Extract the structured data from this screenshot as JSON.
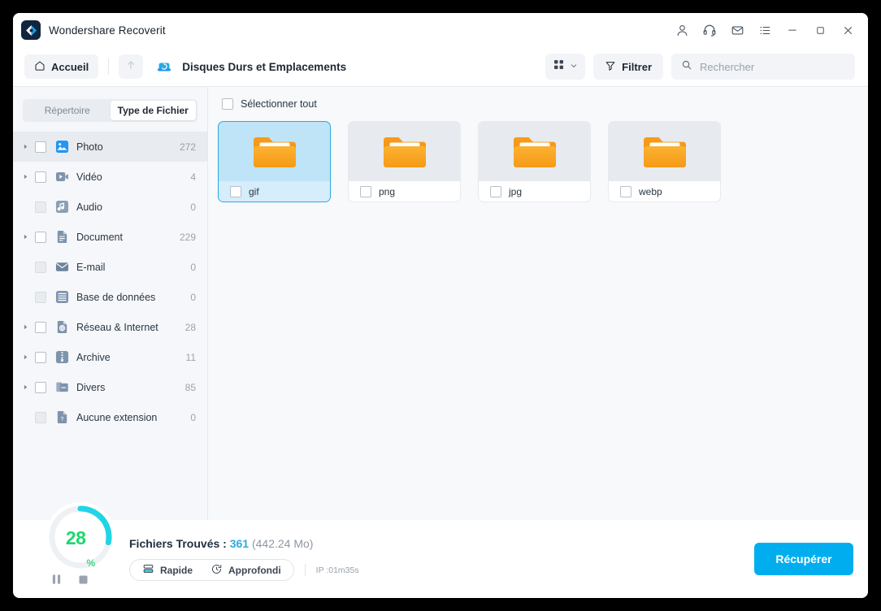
{
  "titlebar": {
    "app_title": "Wondershare Recoverit",
    "logo_name": "wondershare-logo",
    "icons": [
      {
        "name": "account-icon",
        "glyph": "user"
      },
      {
        "name": "support-headset-icon",
        "glyph": "headset"
      },
      {
        "name": "mail-icon",
        "glyph": "mail"
      },
      {
        "name": "menu-list-icon",
        "glyph": "list"
      }
    ],
    "minimize": "minimize-button",
    "maximize": "maximize-button",
    "close": "close-button"
  },
  "toolbar": {
    "home_label": "Accueil",
    "up_label": "up-level-button",
    "location_title": "Disques Durs et Emplacements",
    "filter_label": "Filtrer",
    "view_label": "view-mode-button",
    "search_placeholder": "Rechercher",
    "search_value": ""
  },
  "sidebar": {
    "tabs": [
      {
        "label": "Répertoire",
        "active": false
      },
      {
        "label": "Type de Fichier",
        "active": true
      }
    ],
    "categories": [
      {
        "label": "Photo",
        "count": "272",
        "icon": "photo-icon",
        "color": "#2196f3",
        "expandable": true,
        "enabled": true,
        "selected": true
      },
      {
        "label": "Vidéo",
        "count": "4",
        "icon": "video-icon",
        "color": "#7e93ac",
        "expandable": true,
        "enabled": true,
        "selected": false
      },
      {
        "label": "Audio",
        "count": "0",
        "icon": "audio-icon",
        "color": "#8ba0b6",
        "expandable": false,
        "enabled": false,
        "selected": false
      },
      {
        "label": "Document",
        "count": "229",
        "icon": "document-icon",
        "color": "#7e93ac",
        "expandable": true,
        "enabled": true,
        "selected": false
      },
      {
        "label": "E-mail",
        "count": "0",
        "icon": "email-icon",
        "color": "#6d839c",
        "expandable": false,
        "enabled": false,
        "selected": false
      },
      {
        "label": "Base de données",
        "count": "0",
        "icon": "database-icon",
        "color": "#7e93ac",
        "expandable": false,
        "enabled": false,
        "selected": false
      },
      {
        "label": "Réseau & Internet",
        "count": "28",
        "icon": "network-icon",
        "color": "#7e93ac",
        "expandable": true,
        "enabled": true,
        "selected": false
      },
      {
        "label": "Archive",
        "count": "11",
        "icon": "archive-icon",
        "color": "#7e93ac",
        "expandable": true,
        "enabled": true,
        "selected": false
      },
      {
        "label": "Divers",
        "count": "85",
        "icon": "misc-icon",
        "color": "#7e93ac",
        "expandable": true,
        "enabled": true,
        "selected": false
      },
      {
        "label": "Aucune extension",
        "count": "0",
        "icon": "unknown-file-icon",
        "color": "#7e93ac",
        "expandable": false,
        "enabled": false,
        "selected": false
      }
    ]
  },
  "content": {
    "select_all_label": "Sélectionner tout",
    "select_all_checked": false,
    "cards": [
      {
        "name": "gif",
        "selected": true,
        "checked": false
      },
      {
        "name": "png",
        "selected": false,
        "checked": false
      },
      {
        "name": "jpg",
        "selected": false,
        "checked": false
      },
      {
        "name": "webp",
        "selected": false,
        "checked": false
      }
    ]
  },
  "bottombar": {
    "progress_value": "28",
    "progress_sign": "%",
    "progress_ratio": 0.28,
    "found_label": "Fichiers Trouvés :",
    "found_count": "361",
    "found_size": "(442.24 Mo)",
    "mode_quick": "Rapide",
    "mode_deep": "Approfondi",
    "elapsed": "IP :01m35s",
    "recover_label": "Récupérer",
    "pause_name": "pause-scan-button",
    "stop_name": "stop-scan-button"
  },
  "colors": {
    "accent": "#00aeef",
    "progress_ring": "#21d4e6",
    "progress_text": "#1ed66e",
    "selected_card_border": "#2aa9e0"
  }
}
